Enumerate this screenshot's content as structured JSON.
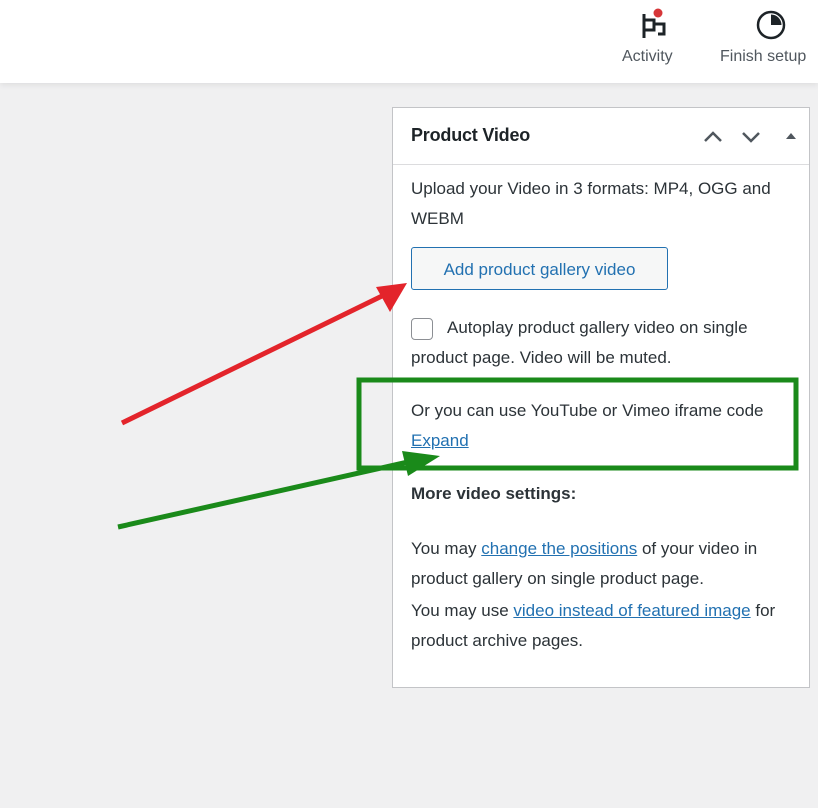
{
  "topbar": {
    "activity_label": "Activity",
    "finish_label": "Finish setup"
  },
  "panel": {
    "title": "Product Video",
    "upload_text": "Upload your Video in 3 formats: MP4, OGG and WEBM",
    "add_button": "Add product gallery video",
    "autoplay_label": "Autoplay product gallery video on single product page. Video will be muted.",
    "iframe_text": "Or you can use YouTube or Vimeo iframe code",
    "expand_link": "Expand",
    "more_settings_heading": "More video settings:",
    "positions_prefix": "You may",
    "positions_link": "change the positions",
    "positions_suffix": "of your video in product gallery on single product page.",
    "featured_prefix": "You may use",
    "featured_link": "video instead of featured image",
    "featured_suffix": "for product archive pages."
  },
  "icons": [
    "flag-icon",
    "progress-circle-icon",
    "chevron-up-icon",
    "chevron-down-icon",
    "caret-up-icon"
  ],
  "colors": {
    "accent": "#2271b1",
    "notification_dot": "#d63638",
    "annotation_red": "#e3242b",
    "annotation_green": "#1a8a1a"
  }
}
